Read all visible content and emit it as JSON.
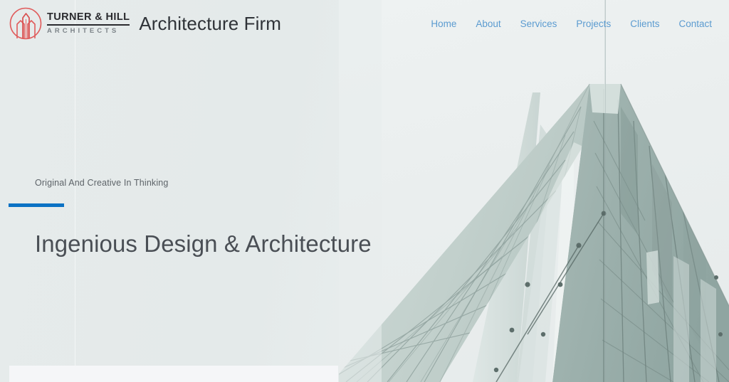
{
  "header": {
    "logo": {
      "mark_icon": "building-towers-circle-icon",
      "mark_color": "#e05c5c",
      "name": "TURNER & HILL",
      "subtitle": "ARCHITECTS"
    },
    "site_title": "Architecture Firm",
    "nav": {
      "items": [
        {
          "label": "Home"
        },
        {
          "label": "About"
        },
        {
          "label": "Services"
        },
        {
          "label": "Projects"
        },
        {
          "label": "Clients"
        },
        {
          "label": "Contact"
        }
      ],
      "link_color": "#5b9bd0"
    }
  },
  "hero": {
    "tagline": "Original And Creative In Thinking",
    "accent_color": "#0b72c4",
    "heading": "Ingenious Design & Architecture",
    "image": {
      "name": "glass-building-facade-photo",
      "description": "Low-angle photograph of a modern glass curtain-wall building against a pale overcast sky"
    }
  },
  "colors": {
    "page_background": "#e4eaea",
    "panel_background": "#f5f6f8",
    "heading_text": "#4a4f55",
    "body_text": "#5d6368"
  }
}
